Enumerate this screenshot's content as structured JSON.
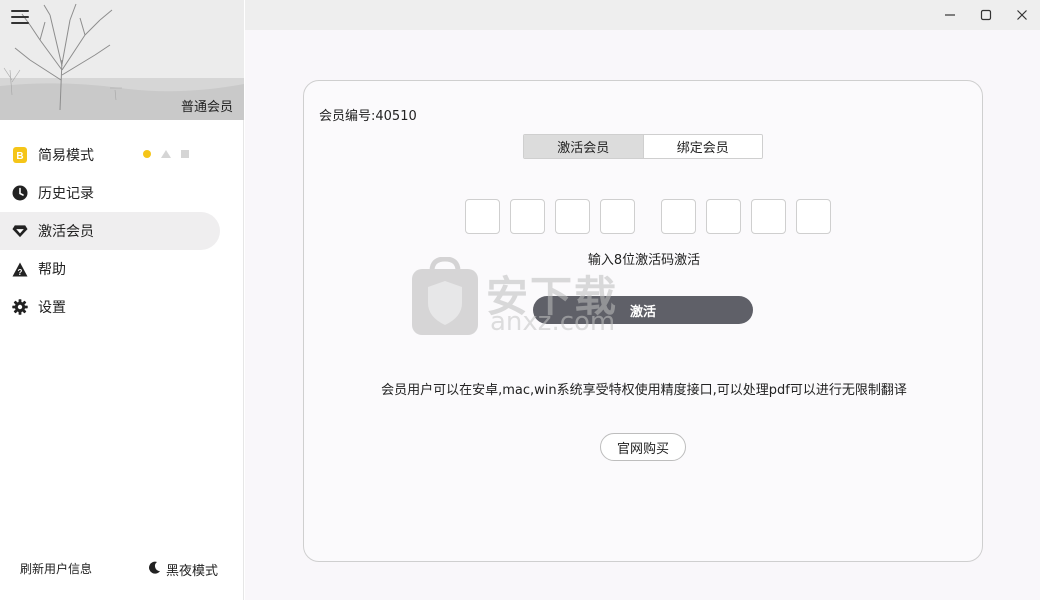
{
  "sidebar": {
    "member_level": "普通会员",
    "items": [
      {
        "label": "简易模式",
        "icon": "b-badge-icon",
        "active": false
      },
      {
        "label": "历史记录",
        "icon": "clock-icon",
        "active": false
      },
      {
        "label": "激活会员",
        "icon": "diamond-icon",
        "active": true
      },
      {
        "label": "帮助",
        "icon": "warning-icon",
        "active": false
      },
      {
        "label": "设置",
        "icon": "gear-icon",
        "active": false
      }
    ],
    "footer": {
      "refresh": "刷新用户信息",
      "dark_mode": "黑夜模式"
    }
  },
  "window_controls": [
    "minimize-icon",
    "maximize-icon",
    "close-icon"
  ],
  "card": {
    "member_id": "会员编号:40510",
    "tabs": [
      {
        "label": "激活会员",
        "active": true
      },
      {
        "label": "绑定会员",
        "active": false
      }
    ],
    "code_hint": "输入8位激活码激活",
    "activate_label": "激活",
    "description": "会员用户可以在安卓,mac,win系统享受特权使用精度接口,可以处理pdf可以进行无限制翻译",
    "buy_label": "官网购买"
  },
  "watermark": {
    "main": "安下载",
    "sub": "anxz.com",
    "shield_char": "安"
  },
  "colors": {
    "accent_yellow": "#f5c518",
    "activate_button": "#5f6068",
    "active_nav_bg": "#efeeef"
  }
}
